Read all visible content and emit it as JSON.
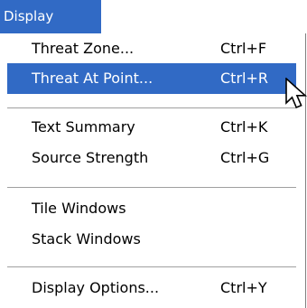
{
  "menu": {
    "title": "Display",
    "items": [
      {
        "label": "Threat Zone...",
        "shortcut": "Ctrl+F"
      },
      {
        "label": "Threat At Point...",
        "shortcut": "Ctrl+R"
      },
      {
        "label": "Text Summary",
        "shortcut": "Ctrl+K"
      },
      {
        "label": "Source Strength",
        "shortcut": "Ctrl+G"
      },
      {
        "label": "Tile Windows",
        "shortcut": ""
      },
      {
        "label": "Stack Windows",
        "shortcut": ""
      },
      {
        "label": "Display Options...",
        "shortcut": "Ctrl+Y"
      }
    ]
  },
  "colors": {
    "highlight": "#316ac5",
    "text": "#000000",
    "highlight_text": "#ffffff"
  },
  "icons": {
    "cursor": "arrow-cursor-icon"
  }
}
